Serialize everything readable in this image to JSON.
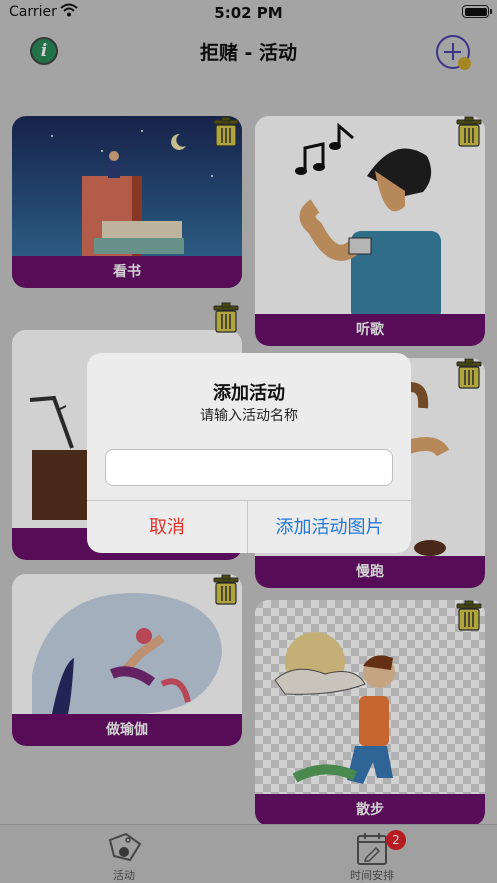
{
  "status_bar": {
    "carrier": "Carrier",
    "time": "5:02 PM"
  },
  "nav": {
    "title": "拒赌 - 活动"
  },
  "activities": [
    {
      "label": "看书",
      "icon": "reading-image"
    },
    {
      "label": "听歌",
      "icon": "music-image"
    },
    {
      "label": "",
      "icon": "cooking-image"
    },
    {
      "label": "慢跑",
      "icon": "jogging-image"
    },
    {
      "label": "做瑜伽",
      "icon": "yoga-image"
    },
    {
      "label": "散步",
      "icon": "walking-image"
    }
  ],
  "tabs": [
    {
      "label": "活动",
      "icon": "activity-tag-icon"
    },
    {
      "label": "时间安排",
      "icon": "calendar-icon",
      "badge": "2"
    }
  ],
  "alert": {
    "title": "添加活动",
    "message": "请输入活动名称",
    "input_value": "",
    "input_placeholder": "",
    "cancel_label": "取消",
    "confirm_label": "添加活动图片"
  },
  "colors": {
    "label_bg": "#6b0f6b",
    "cancel": "#e0332a",
    "confirm": "#2277dd",
    "accent": "#4b3fa8"
  }
}
